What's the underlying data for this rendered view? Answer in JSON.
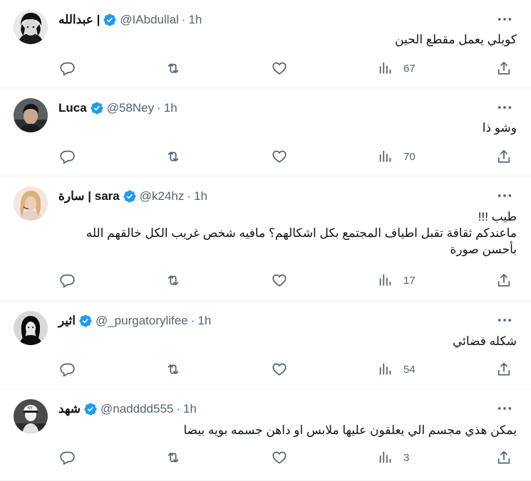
{
  "tweets": [
    {
      "name": "عبدالله |",
      "handle": "@IAbdullal",
      "dot": "·",
      "time": "1h",
      "text": "كويلي يعمل مقطع الحين",
      "views": "67"
    },
    {
      "name": "Luca",
      "handle": "@58Ney",
      "dot": "·",
      "time": "1h",
      "text": "وشو ذا",
      "views": "70"
    },
    {
      "name": "سارة | sara",
      "handle": "@k24hz",
      "dot": "·",
      "time": "1h",
      "text": "طيب !!!\nماعندكم ثقافة تقبل اطياف المجتمع بكل اشكالهم؟ مافيه شخص غريب الكل خالقهم الله\nبأحسن صورة",
      "views": "17"
    },
    {
      "name": "اثير",
      "handle": "@_purgatorylifee",
      "dot": "·",
      "time": "1h",
      "text": "شكله فضائي",
      "views": "54"
    },
    {
      "name": "شهد",
      "handle": "@nadddd555",
      "dot": "·",
      "time": "1h",
      "text": "يمكن هذي مجسم الي يعلقون عليها ملابس او داهن جسمه بويه بيضا",
      "views": "3"
    }
  ],
  "colors": {
    "verified": "#1d9bf0",
    "text": "#0f1419",
    "secondary": "#536471",
    "divider": "#eff3f4"
  },
  "icons": [
    "reply-icon",
    "retweet-icon",
    "like-icon",
    "views-icon",
    "share-icon",
    "more-icon",
    "verified-badge-icon"
  ]
}
